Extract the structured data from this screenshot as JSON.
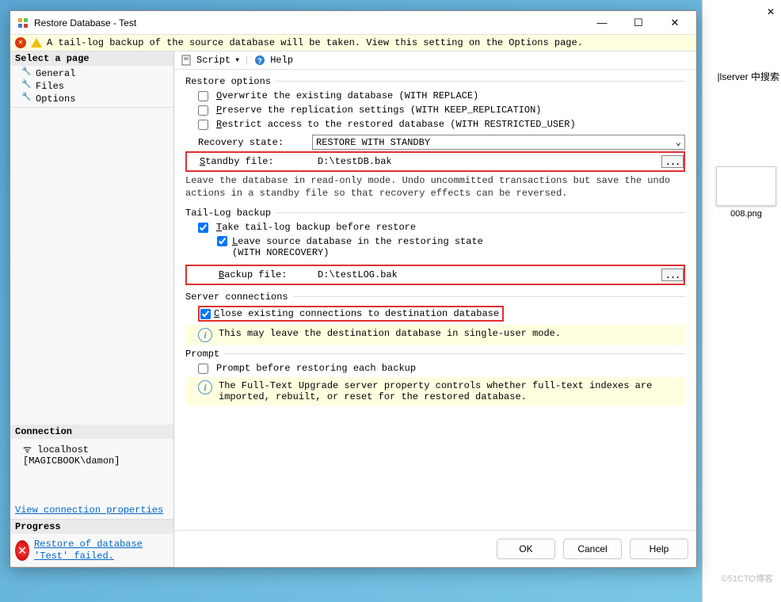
{
  "window": {
    "title": "Restore Database - Test",
    "minimize": "—",
    "maximize": "☐",
    "close": "✕"
  },
  "notice": {
    "text": "A tail-log backup of the source database will be taken. View this setting on the Options page."
  },
  "sidebar": {
    "select_page": "Select a page",
    "items": [
      "General",
      "Files",
      "Options"
    ],
    "connection_header": "Connection",
    "connection_text": "localhost [MAGICBOOK\\damon]",
    "connection_link": "View connection properties",
    "progress_header": "Progress",
    "progress_link": "Restore of database 'Test' failed."
  },
  "toolbar": {
    "script": "Script",
    "help": "Help"
  },
  "restore_options": {
    "header": "Restore options",
    "overwrite": "Overwrite the existing database (WITH REPLACE)",
    "preserve": "Preserve the replication settings (WITH KEEP_REPLICATION)",
    "restrict": "Restrict access to the restored database (WITH RESTRICTED_USER)",
    "recovery_label": "Recovery state:",
    "recovery_value": "RESTORE WITH STANDBY",
    "standby_label": "Standby file:",
    "standby_value": "D:\\testDB.bak",
    "desc": "Leave the database in read-only mode. Undo uncommitted transactions but save the undo actions in a standby file so that recovery effects can be reversed."
  },
  "tail_log": {
    "header": "Tail-Log backup",
    "take": "Take tail-log backup before restore",
    "leave": "Leave source database in the restoring state\n(WITH NORECOVERY)",
    "backup_label": "Backup file:",
    "backup_value": "D:\\testLOG.bak"
  },
  "server_conn": {
    "header": "Server connections",
    "close_existing": "Close existing connections to destination database",
    "info": "This may leave the destination database in single-user mode."
  },
  "prompt": {
    "header": "Prompt",
    "prompt_before": "Prompt before restoring each backup",
    "info": "The Full-Text Upgrade server property controls whether full-text indexes are imported, rebuilt, or reset for the restored database."
  },
  "footer": {
    "ok": "OK",
    "cancel": "Cancel",
    "help": "Help"
  },
  "bg": {
    "search": "|lserver 中搜索",
    "thumb": "008.png"
  },
  "watermark": "©51CTO博客"
}
